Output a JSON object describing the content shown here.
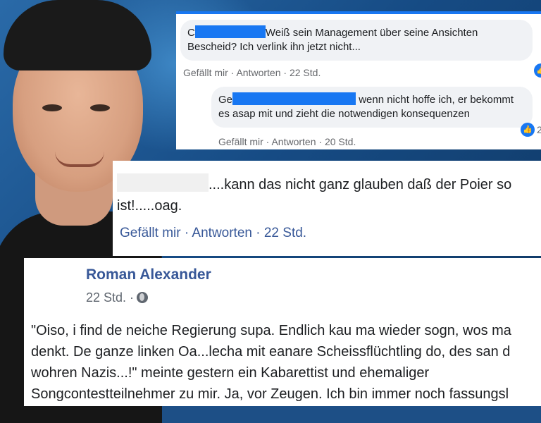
{
  "comment1": {
    "author_initial": "C",
    "text": "Weiß sein Management über seine Ansichten Bescheid? Ich verlink ihn jetzt nicht...",
    "like": "Gefällt mir",
    "reply": "Antworten",
    "time": "22 Std."
  },
  "reply1": {
    "author_initial": "Ge",
    "text_line1": "wenn nicht hoffe ich, er bekommt",
    "text_line2": "es asap mit und zieht die notwendigen konsequenzen",
    "like": "Gefällt mir",
    "reply": "Antworten",
    "time": "20 Std.",
    "badge": "2"
  },
  "comment2": {
    "text_line1": "....kann das nicht ganz glauben daß der Poier so",
    "text_line2": "ist!.....oag.",
    "like": "Gefällt mir",
    "reply": "Antworten",
    "time": "22 Std."
  },
  "post": {
    "author": "Roman Alexander",
    "time": "22 Std. ·",
    "lines": [
      "\"Oiso, i find de neiche Regierung supa. Endlich kau ma wieder sogn, wos ma",
      "denkt. De ganze linken Oa...lecha mit eanare Scheissflüchtling do, des san d",
      "wohren Nazis...!\" meinte gestern ein Kabarettist und ehemaliger",
      "Songcontestteilnehmer zu mir. Ja, vor Zeugen. Ich bin immer noch fassungsl"
    ]
  },
  "colors": {
    "facebook_blue": "#1877f2",
    "link_blue": "#385898",
    "meta_gray": "#65676b"
  }
}
